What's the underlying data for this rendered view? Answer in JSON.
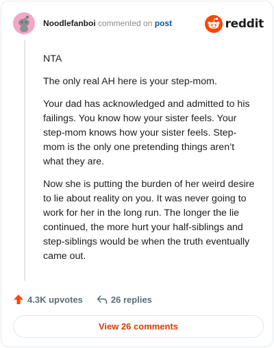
{
  "header": {
    "username": "Noodlefanboi",
    "action": "commented on",
    "post_link": "post",
    "brand": "reddit"
  },
  "comment": {
    "paragraphs": [
      "NTA",
      "The only real AH here is your step-mom.",
      "Your dad has acknowledged and admitted to his failings. You know how your sister feels. Your step-mom knows how your sister feels. Step-mom is the only one pretending things aren’t what they are.",
      "Now she is putting the burden of her weird desire to lie about reality on you. It was never going to work for her in the long run. The longer the lie continued, the more hurt your half-siblings and step-siblings would be when the truth eventually came out."
    ]
  },
  "footer": {
    "upvotes": "4.3K upvotes",
    "replies": "26 replies",
    "view_button": "View 26 comments"
  },
  "colors": {
    "accent": "#ff4500",
    "link": "#0a4fa3",
    "muted": "#576f76"
  }
}
